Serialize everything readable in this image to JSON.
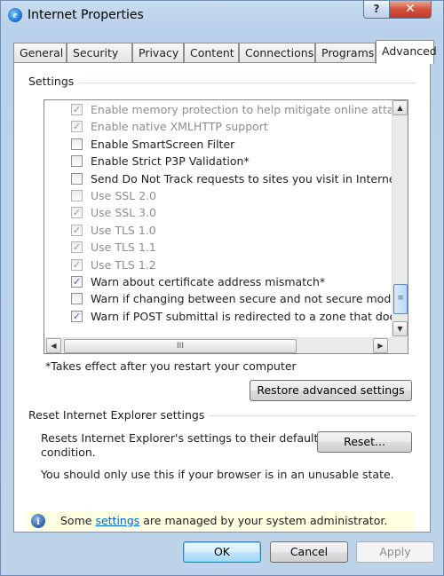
{
  "window": {
    "title": "Internet Properties",
    "app_icon": "internet-explorer-icon",
    "help_glyph": "?",
    "close_glyph": "✕"
  },
  "tabs": [
    {
      "label": "General"
    },
    {
      "label": "Security"
    },
    {
      "label": "Privacy"
    },
    {
      "label": "Content"
    },
    {
      "label": "Connections"
    },
    {
      "label": "Programs"
    },
    {
      "label": "Advanced",
      "active": true
    }
  ],
  "settings": {
    "group_label": "Settings",
    "items": [
      {
        "label": "Enable memory protection to help mitigate online attacks*",
        "checked": true,
        "disabled": true
      },
      {
        "label": "Enable native XMLHTTP support",
        "checked": true,
        "disabled": true
      },
      {
        "label": "Enable SmartScreen Filter",
        "checked": false,
        "disabled": false
      },
      {
        "label": "Enable Strict P3P Validation*",
        "checked": false,
        "disabled": false
      },
      {
        "label": "Send Do Not Track requests to sites you visit in Internet E",
        "checked": false,
        "disabled": false
      },
      {
        "label": "Use SSL 2.0",
        "checked": false,
        "disabled": true
      },
      {
        "label": "Use SSL 3.0",
        "checked": true,
        "disabled": true
      },
      {
        "label": "Use TLS 1.0",
        "checked": true,
        "disabled": true
      },
      {
        "label": "Use TLS 1.1",
        "checked": true,
        "disabled": true
      },
      {
        "label": "Use TLS 1.2",
        "checked": true,
        "disabled": true
      },
      {
        "label": "Warn about certificate address mismatch*",
        "checked": true,
        "disabled": false
      },
      {
        "label": "Warn if changing between secure and not secure mode",
        "checked": false,
        "disabled": false
      },
      {
        "label": "Warn if POST submittal is redirected to a zone that does n",
        "checked": true,
        "disabled": false
      }
    ],
    "footnote": "*Takes effect after you restart your computer",
    "restore_button": "Restore advanced settings",
    "scroll_up_glyph": "▲",
    "scroll_down_glyph": "▼",
    "scroll_left_glyph": "◀",
    "scroll_right_glyph": "▶",
    "grip_glyph": "≡",
    "hgrip_glyph": "III"
  },
  "reset": {
    "group_label": "Reset Internet Explorer settings",
    "description_line1": "Resets Internet Explorer's settings to their default",
    "description_line2": "condition.",
    "button": "Reset...",
    "note": "You should only use this if your browser is in an unusable state."
  },
  "info_bar": {
    "icon": "info-icon",
    "icon_glyph": "i",
    "text_before": "Some ",
    "link": "settings",
    "text_after": " are managed by your system administrator."
  },
  "dialog_buttons": {
    "ok": "OK",
    "cancel": "Cancel",
    "apply": "Apply"
  },
  "colors": {
    "title_bar": "#b9d1ea",
    "close_button": "#c0392b",
    "info_bar_bg": "#ffffe1",
    "link": "#0066cc"
  }
}
